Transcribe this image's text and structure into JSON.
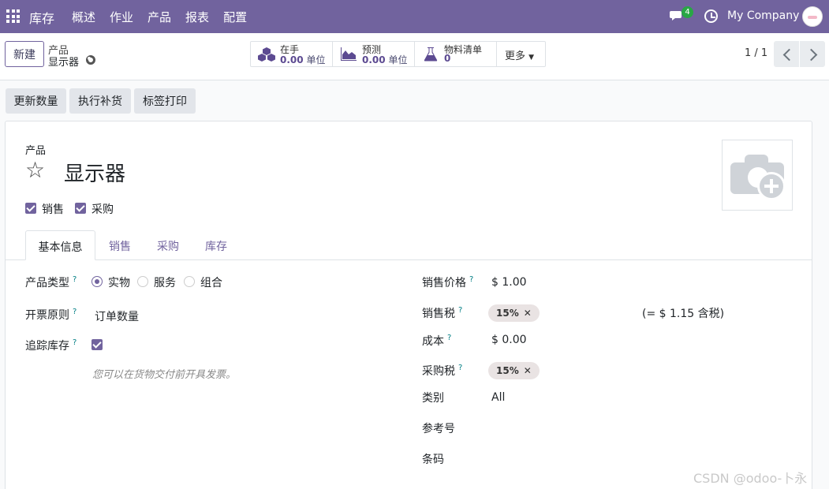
{
  "navbar": {
    "app_name": "库存",
    "menu": [
      "概述",
      "作业",
      "产品",
      "报表",
      "配置"
    ],
    "chat_badge": "4",
    "company": "My Company"
  },
  "control": {
    "new_button": "新建",
    "breadcrumb_parent": "产品",
    "breadcrumb_current": "显示器",
    "smart_buttons": [
      {
        "title": "在手",
        "value": "0.00",
        "unit": "单位"
      },
      {
        "title": "预测",
        "value": "0.00",
        "unit": "单位"
      },
      {
        "title": "物料清单",
        "value": "0",
        "unit": ""
      }
    ],
    "more_label": "更多",
    "pager": "1 / 1"
  },
  "actions": [
    "更新数量",
    "执行补货",
    "标签打印"
  ],
  "form": {
    "product_label": "产品",
    "product_name": "显示器",
    "checkbox_sale": "销售",
    "checkbox_purchase": "采购",
    "tabs": [
      "基本信息",
      "销售",
      "采购",
      "库存"
    ],
    "left": {
      "type_label": "产品类型",
      "type_options": [
        "实物",
        "服务",
        "组合"
      ],
      "invoice_label": "开票原则",
      "invoice_value": "订单数量",
      "track_label": "追踪库存",
      "hint": "您可以在货物交付前开具发票。"
    },
    "right": {
      "price_label": "销售价格",
      "price_value": "$ 1.00",
      "sale_tax_label": "销售税",
      "sale_tax_tag": "15%",
      "tax_incl": "(= $ 1.15 含税)",
      "cost_label": "成本",
      "cost_value": "$ 0.00",
      "purchase_tax_label": "采购税",
      "purchase_tax_tag": "15%",
      "category_label": "类别",
      "category_value": "All",
      "ref_label": "参考号",
      "barcode_label": "条码"
    }
  },
  "watermark": "CSDN @odoo-卜永"
}
